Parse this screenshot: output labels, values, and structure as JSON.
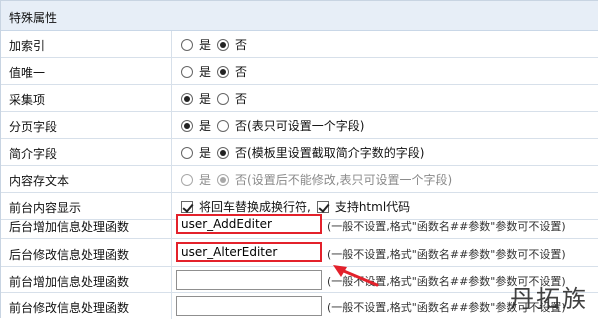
{
  "section_title": "特殊属性",
  "rows": {
    "add_index": {
      "label": "加索引",
      "opt_yes": "是",
      "opt_no": "否",
      "selected": "否"
    },
    "unique": {
      "label": "值唯一",
      "opt_yes": "是",
      "opt_no": "否",
      "selected": "否"
    },
    "collect_item": {
      "label": "采集项",
      "opt_yes": "是",
      "opt_no": "否",
      "selected": "是"
    },
    "paging_field": {
      "label": "分页字段",
      "opt_yes": "是",
      "opt_no": "否(表只可设置一个字段)",
      "selected": "是"
    },
    "summary_field": {
      "label": "简介字段",
      "opt_yes": "是",
      "opt_no": "否(模板里设置截取简介字数的字段)",
      "selected": "否"
    },
    "content_text": {
      "label": "内容存文本",
      "opt_yes": "是",
      "opt_no": "否(设置后不能修改,表只可设置一个字段)",
      "selected": "否",
      "disabled": true
    },
    "frontend_display": {
      "label": "前台内容显示",
      "check1": "将回车替换成换行符,",
      "check2": "支持html代码",
      "check1_checked": true,
      "check2_checked": true
    },
    "backend_add_func": {
      "label": "后台增加信息处理函数",
      "value": "user_AddEditer",
      "hint": "(一般不设置,格式\"函数名##参数\"参数可不设置)"
    },
    "backend_edit_func": {
      "label": "后台修改信息处理函数",
      "value": "user_AlterEditer",
      "hint": "(一般不设置,格式\"函数名##参数\"参数可不设置)"
    },
    "frontend_add_func": {
      "label": "前台增加信息处理函数",
      "value": "",
      "hint": "(一般不设置,格式\"函数名##参数\"参数可不设置)"
    },
    "frontend_edit_func": {
      "label": "前台修改信息处理函数",
      "value": "",
      "hint": "(一般不设置,格式\"函数名##参数\"参数可不设置)"
    }
  },
  "watermark": "丹拓族",
  "colors": {
    "header_bg": "#e7eef7",
    "highlight": "#e3212b",
    "border": "#d7e0ea"
  }
}
